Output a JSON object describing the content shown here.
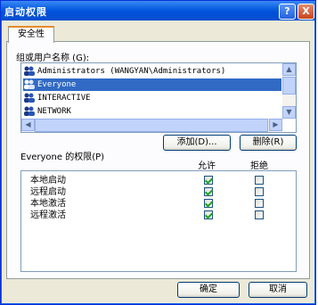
{
  "window": {
    "title": "启动权限"
  },
  "titlebar": {
    "help_label": "?",
    "close_label": "X"
  },
  "tabs": [
    {
      "label": "安全性"
    }
  ],
  "principals": {
    "label": "组或用户名称 (G):",
    "items": [
      {
        "name": "Administrators (WANGYAN\\Administrators)",
        "selected": false
      },
      {
        "name": "Everyone",
        "selected": true
      },
      {
        "name": "INTERACTIVE",
        "selected": false
      },
      {
        "name": "NETWORK",
        "selected": false
      }
    ],
    "scroll_up": "▲",
    "scroll_down": "▼",
    "scroll_left": "◀",
    "scroll_right": "▶"
  },
  "buttons": {
    "add": "添加(D)...",
    "remove": "删除(R)",
    "ok": "确定",
    "cancel": "取消"
  },
  "permissions": {
    "label": "Everyone 的权限(P)",
    "allow_header": "允许",
    "deny_header": "拒绝",
    "rows": [
      {
        "name": "本地启动",
        "allow": true,
        "deny": false
      },
      {
        "name": "远程启动",
        "allow": true,
        "deny": false
      },
      {
        "name": "本地激活",
        "allow": true,
        "deny": false
      },
      {
        "name": "远程激活",
        "allow": true,
        "deny": false
      }
    ]
  },
  "colors": {
    "titlebar": "#0a5fe0",
    "selection": "#316ac5",
    "dialog_bg": "#ece9d8",
    "tab_accent": "#e68b2c"
  }
}
